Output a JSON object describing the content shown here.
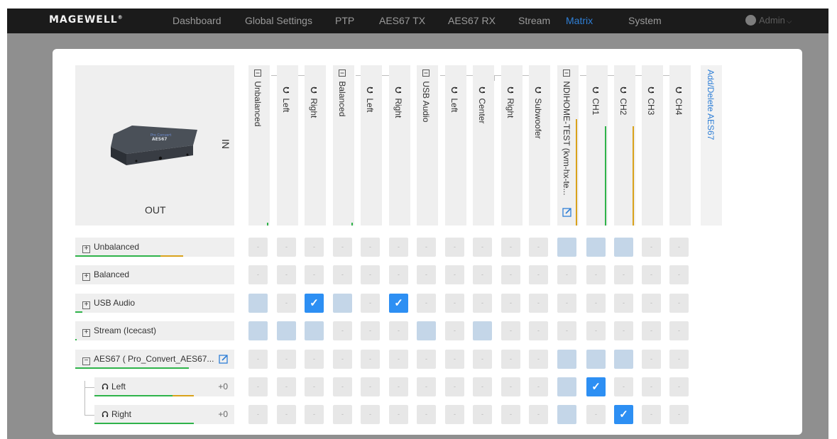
{
  "brand": {
    "logo": "MAGEWELL",
    "mark": "®"
  },
  "nav": [
    "Dashboard",
    "Global Settings",
    "PTP",
    "AES67 TX",
    "AES67 RX",
    "Stream",
    "Matrix",
    "System"
  ],
  "nav_active": "Matrix",
  "user": {
    "name": "Admin",
    "chevron": "chevron-down-icon"
  },
  "device": {
    "in_label": "IN",
    "out_label": "OUT",
    "image_text": [
      "Pro Convert",
      "AES67"
    ]
  },
  "columns": [
    {
      "label": "Unbalanced",
      "parent": true
    },
    {
      "label": "Left",
      "parent": false
    },
    {
      "label": "Right",
      "parent": false
    },
    {
      "label": "Balanced",
      "parent": true
    },
    {
      "label": "Left",
      "parent": false
    },
    {
      "label": "Right",
      "parent": false
    },
    {
      "label": "USB Audio",
      "parent": true
    },
    {
      "label": "Left",
      "parent": false
    },
    {
      "label": "Center",
      "parent": false
    },
    {
      "label": "Right",
      "parent": false
    },
    {
      "label": "Subwoofer",
      "parent": false
    },
    {
      "label": "NDIHOME-TEST (kvm-hx-te...",
      "parent": true
    },
    {
      "label": "CH1",
      "parent": false
    },
    {
      "label": "CH2",
      "parent": false
    },
    {
      "label": "CH3",
      "parent": false
    },
    {
      "label": "CH4",
      "parent": false
    }
  ],
  "add_delete": "Add/Delete AES67",
  "rows": [
    {
      "label": "Unbalanced",
      "expander": "+",
      "child": false
    },
    {
      "label": "Balanced",
      "expander": "+",
      "child": false
    },
    {
      "label": "USB Audio",
      "expander": "+",
      "child": false
    },
    {
      "label": "Stream (Icecast)",
      "expander": "+",
      "child": false
    },
    {
      "label": "AES67 ( Pro_Convert_AES67...",
      "expander": "−",
      "child": false,
      "editable": true
    },
    {
      "label": "Left",
      "expander": "",
      "child": true,
      "gain": "+0"
    },
    {
      "label": "Right",
      "expander": "",
      "child": true,
      "gain": "+0"
    }
  ],
  "empty_cell": "-",
  "matrix": [
    [
      "e",
      "e",
      "e",
      "e",
      "e",
      "e",
      "e",
      "e",
      "e",
      "e",
      "e",
      "l",
      "l",
      "l",
      "e",
      "e"
    ],
    [
      "e",
      "e",
      "e",
      "e",
      "e",
      "e",
      "e",
      "e",
      "e",
      "e",
      "e",
      "e",
      "e",
      "e",
      "e",
      "e"
    ],
    [
      "l",
      "e",
      "c",
      "l",
      "e",
      "c",
      "e",
      "e",
      "e",
      "e",
      "e",
      "e",
      "e",
      "e",
      "e",
      "e"
    ],
    [
      "l",
      "l",
      "l",
      "e",
      "e",
      "e",
      "l",
      "e",
      "l",
      "e",
      "e",
      "e",
      "e",
      "e",
      "e",
      "e"
    ],
    [
      "e",
      "e",
      "e",
      "e",
      "e",
      "e",
      "e",
      "e",
      "e",
      "e",
      "e",
      "l",
      "l",
      "l",
      "e",
      "e"
    ],
    [
      "e",
      "e",
      "e",
      "e",
      "e",
      "e",
      "e",
      "e",
      "e",
      "e",
      "e",
      "l",
      "c",
      "e",
      "e",
      "e"
    ],
    [
      "e",
      "e",
      "e",
      "e",
      "e",
      "e",
      "e",
      "e",
      "e",
      "e",
      "e",
      "l",
      "e",
      "c",
      "e",
      "e"
    ]
  ],
  "colors": {
    "accent": "#2f7fd6",
    "checked": "#2d8ff3",
    "routed": "#c4d6e8",
    "level_green": "#2fb34a",
    "level_amber": "#d9a21b"
  }
}
